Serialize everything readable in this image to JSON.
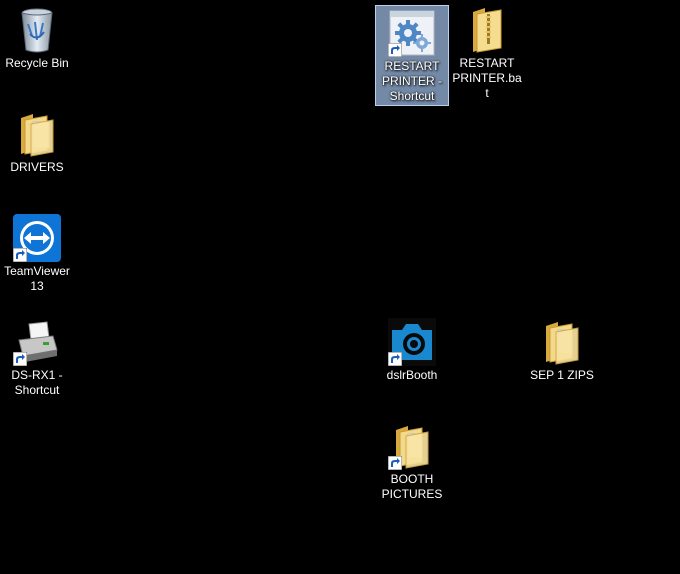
{
  "desktop": {
    "background_color": "#000000",
    "icons": [
      {
        "id": "recycle-bin",
        "label": "Recycle Bin",
        "icon": "recycle-bin-icon",
        "shortcut": false,
        "selected": false
      },
      {
        "id": "drivers",
        "label": "DRIVERS",
        "icon": "folder-icon",
        "shortcut": false,
        "selected": false
      },
      {
        "id": "teamviewer",
        "label": "TeamViewer 13",
        "icon": "teamviewer-icon",
        "shortcut": true,
        "selected": false
      },
      {
        "id": "ds-rx1",
        "label": "DS-RX1 - Shortcut",
        "icon": "printer-icon",
        "shortcut": true,
        "selected": false
      },
      {
        "id": "restart-printer-shortcut",
        "label": "RESTART PRINTER - Shortcut",
        "icon": "gear-settings-icon",
        "shortcut": true,
        "selected": true
      },
      {
        "id": "restart-printer-bat",
        "label": "RESTART PRINTER.bat",
        "icon": "zip-folder-icon",
        "shortcut": false,
        "selected": false
      },
      {
        "id": "dslrbooth",
        "label": "dslrBooth",
        "icon": "camera-icon",
        "shortcut": true,
        "selected": false
      },
      {
        "id": "sep-1-zips",
        "label": "SEP 1 ZIPS",
        "icon": "folder-icon",
        "shortcut": false,
        "selected": false
      },
      {
        "id": "booth-pictures",
        "label": "BOOTH PICTURES",
        "icon": "folder-icon",
        "shortcut": true,
        "selected": false
      }
    ]
  }
}
